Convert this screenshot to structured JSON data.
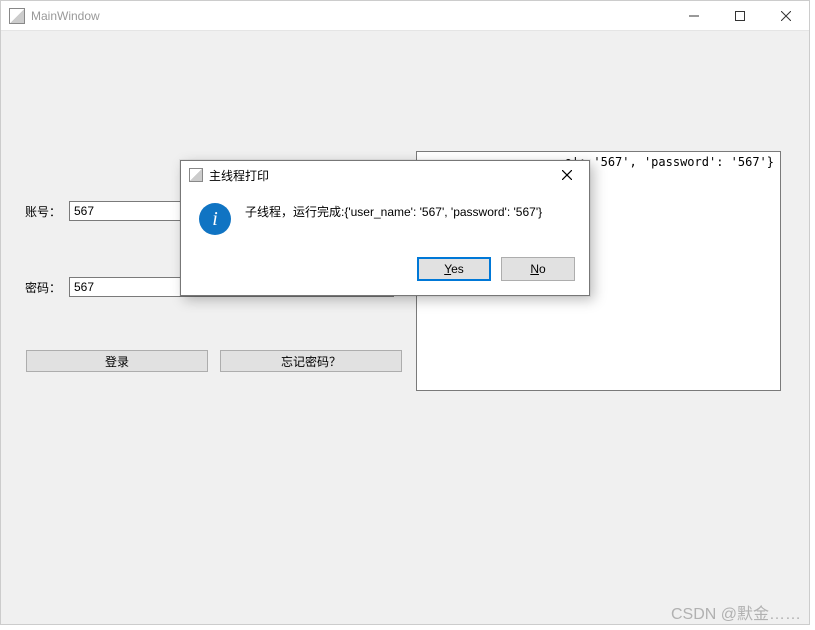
{
  "window": {
    "title": "MainWindow"
  },
  "form": {
    "account_label": "账号：",
    "account_value": "567",
    "password_label": "密码：",
    "password_value": "567",
    "login_button": "登录",
    "forgot_button": "忘记密码？"
  },
  "output": {
    "text": "e': '567', 'password': '567'}"
  },
  "dialog": {
    "title": "主线程打印",
    "icon": "info",
    "message": "子线程，运行完成:{'user_name': '567', 'password': '567'}",
    "yes_prefix": "Y",
    "yes_rest": "es",
    "no_prefix": "N",
    "no_rest": "o"
  },
  "watermark": "CSDN @默金……"
}
